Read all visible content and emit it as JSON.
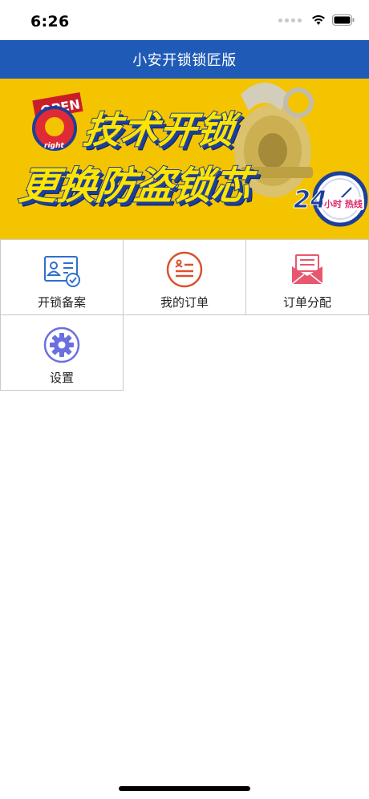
{
  "status_bar": {
    "time": "6:26"
  },
  "nav": {
    "title": "小安开锁锁匠版"
  },
  "banner": {
    "line1": "技术开锁",
    "line2": "更换防盗锁芯",
    "logo_text": "OPEN",
    "logo_sub": "right",
    "badge_number": "24",
    "badge_text": "小时 热线"
  },
  "menu": [
    {
      "label": "开锁备案",
      "icon": "id-card-check-icon",
      "color": "#2f6fcf"
    },
    {
      "label": "我的订单",
      "icon": "order-list-icon",
      "color": "#d9532c"
    },
    {
      "label": "订单分配",
      "icon": "envelope-icon",
      "color": "#e8576f"
    },
    {
      "label": "设置",
      "icon": "gear-icon",
      "color": "#6b6fe0"
    }
  ],
  "colors": {
    "nav": "#1f5bb6",
    "banner_bg": "#f4c400"
  }
}
